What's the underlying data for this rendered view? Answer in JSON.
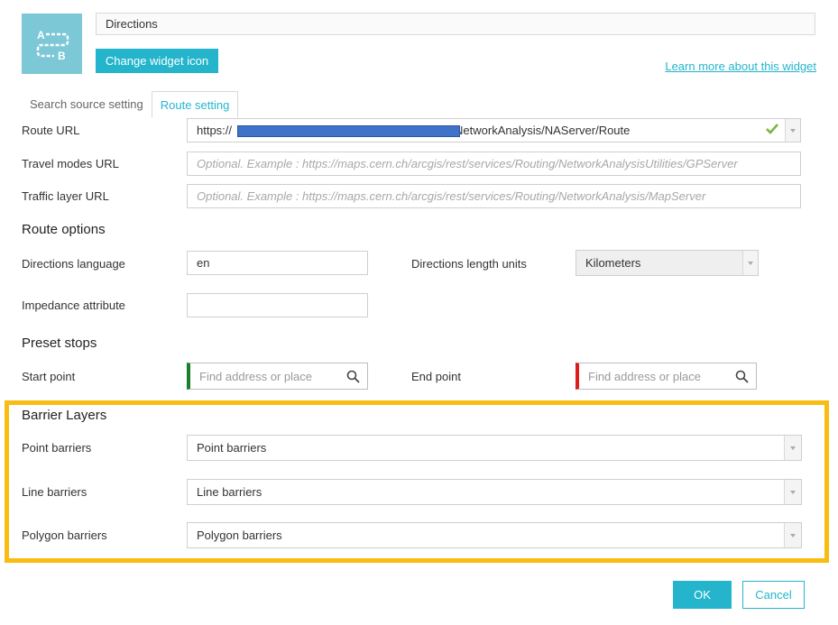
{
  "header": {
    "title_value": "Directions",
    "change_icon_label": "Change widget icon",
    "learn_more_label": "Learn more about this widget"
  },
  "tabs": [
    {
      "label": "Search source setting",
      "active": false
    },
    {
      "label": "Route setting",
      "active": true
    }
  ],
  "route": {
    "route_url_label": "Route URL",
    "route_url_prefix": "https://",
    "route_url_suffix": "NetworkAnalysis/NAServer/Route",
    "travel_modes_label": "Travel modes URL",
    "travel_modes_placeholder": "Optional. Example : https://maps.cern.ch/arcgis/rest/services/Routing/NetworkAnalysisUtilities/GPServer",
    "traffic_layer_label": "Traffic layer URL",
    "traffic_layer_placeholder": "Optional. Example : https://maps.cern.ch/arcgis/rest/services/Routing/NetworkAnalysis/MapServer"
  },
  "route_options": {
    "heading": "Route options",
    "language_label": "Directions language",
    "language_value": "en",
    "length_units_label": "Directions length units",
    "length_units_value": "Kilometers",
    "impedance_label": "Impedance attribute",
    "impedance_value": ""
  },
  "preset_stops": {
    "heading": "Preset stops",
    "start_label": "Start point",
    "start_placeholder": "Find address or place",
    "end_label": "End point",
    "end_placeholder": "Find address or place",
    "start_color": "#1a7f2a",
    "end_color": "#e01b1b"
  },
  "barrier_layers": {
    "heading": "Barrier Layers",
    "point_label": "Point barriers",
    "point_value": "Point barriers",
    "line_label": "Line barriers",
    "line_value": "Line barriers",
    "polygon_label": "Polygon barriers",
    "polygon_value": "Polygon barriers",
    "highlight_color": "#f8bc13"
  },
  "footer": {
    "ok_label": "OK",
    "cancel_label": "Cancel"
  },
  "colors": {
    "accent": "#24b5cc",
    "icon_bg": "#7cc8d6",
    "valid_check": "#7cb342"
  },
  "icons": {
    "widget_icon": "directions-a-to-b-icon",
    "search_icon": "magnifier-icon",
    "check_icon": "checkmark-icon",
    "dropdown_icon": "chevron-down-icon"
  }
}
